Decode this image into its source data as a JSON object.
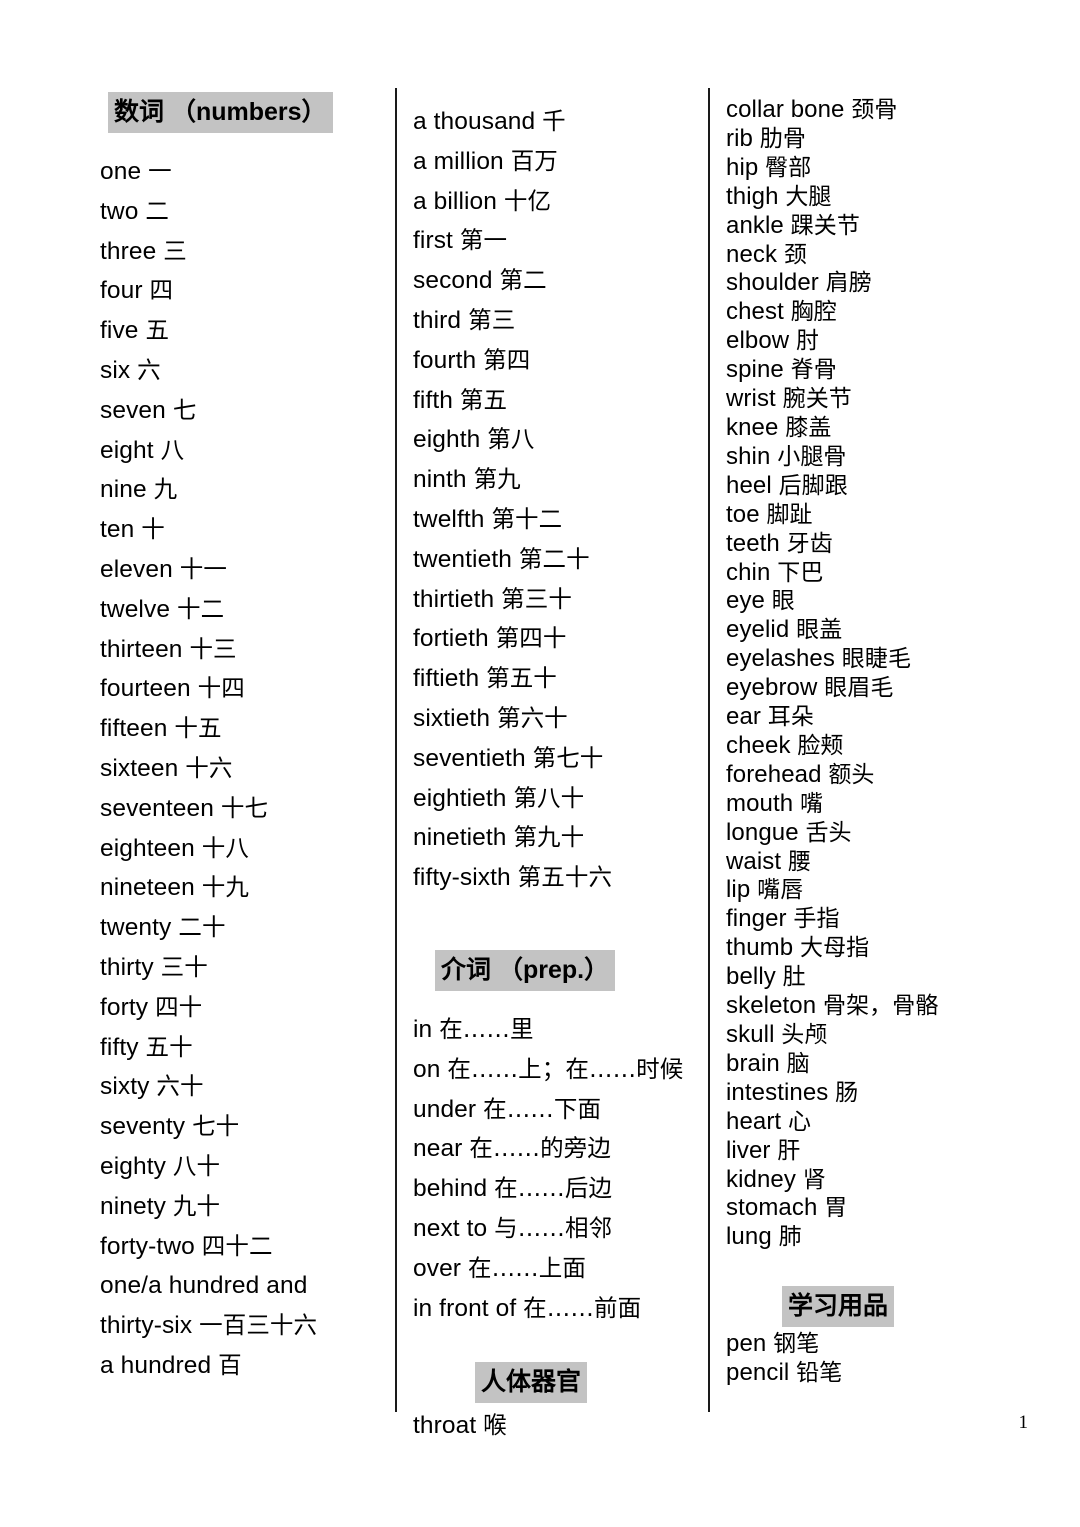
{
  "document": {
    "page_number": "1"
  },
  "columns": [
    {
      "id": "column-1",
      "sections": [
        {
          "heading": "数词 （numbers）",
          "entries": [
            {
              "en": "one",
              "cn": "一"
            },
            {
              "en": "two",
              "cn": "二"
            },
            {
              "en": "three",
              "cn": "三"
            },
            {
              "en": "four",
              "cn": "四"
            },
            {
              "en": "five",
              "cn": "五"
            },
            {
              "en": "six",
              "cn": "六"
            },
            {
              "en": "seven",
              "cn": "七"
            },
            {
              "en": "eight",
              "cn": "八"
            },
            {
              "en": "nine",
              "cn": "九"
            },
            {
              "en": "ten",
              "cn": "十"
            },
            {
              "en": "eleven",
              "cn": "十一"
            },
            {
              "en": "twelve",
              "cn": "十二"
            },
            {
              "en": "thirteen",
              "cn": "十三"
            },
            {
              "en": "fourteen",
              "cn": "十四"
            },
            {
              "en": "fifteen",
              "cn": "十五"
            },
            {
              "en": "sixteen",
              "cn": "十六"
            },
            {
              "en": "seventeen",
              "cn": "十七"
            },
            {
              "en": "eighteen",
              "cn": "十八"
            },
            {
              "en": "nineteen",
              "cn": "十九"
            },
            {
              "en": "twenty",
              "cn": "二十"
            },
            {
              "en": "thirty",
              "cn": "三十"
            },
            {
              "en": "forty",
              "cn": "四十"
            },
            {
              "en": "fifty",
              "cn": "五十"
            },
            {
              "en": "sixty",
              "cn": "六十"
            },
            {
              "en": "seventy",
              "cn": "七十"
            },
            {
              "en": "eighty",
              "cn": "八十"
            },
            {
              "en": "ninety",
              "cn": "九十"
            },
            {
              "en": "forty-two",
              "cn": "四十二"
            },
            {
              "en": "one/a hundred and",
              "cn": ""
            },
            {
              "en": "thirty-six",
              "cn": "一百三十六"
            },
            {
              "en": "a hundred",
              "cn": "百"
            }
          ]
        }
      ]
    },
    {
      "id": "column-2",
      "sections": [
        {
          "heading": "",
          "entries": [
            {
              "en": "a thousand",
              "cn": "千"
            },
            {
              "en": "a million",
              "cn": "百万"
            },
            {
              "en": "a billion",
              "cn": "十亿"
            },
            {
              "en": "first",
              "cn": "第一"
            },
            {
              "en": "second",
              "cn": "第二"
            },
            {
              "en": "third",
              "cn": "第三"
            },
            {
              "en": "fourth",
              "cn": "第四"
            },
            {
              "en": "fifth",
              "cn": "第五"
            },
            {
              "en": "eighth",
              "cn": "第八"
            },
            {
              "en": "ninth",
              "cn": "第九"
            },
            {
              "en": "twelfth",
              "cn": "第十二"
            },
            {
              "en": "twentieth",
              "cn": "第二十"
            },
            {
              "en": "thirtieth",
              "cn": "第三十"
            },
            {
              "en": "fortieth",
              "cn": "第四十"
            },
            {
              "en": "fiftieth",
              "cn": "第五十"
            },
            {
              "en": "sixtieth",
              "cn": "第六十"
            },
            {
              "en": "seventieth",
              "cn": "第七十"
            },
            {
              "en": "eightieth",
              "cn": "第八十"
            },
            {
              "en": "ninetieth",
              "cn": "第九十"
            },
            {
              "en": "fifty-sixth",
              "cn": "第五十六"
            }
          ]
        },
        {
          "heading": "介词 （prep.）",
          "entries": [
            {
              "en": "in",
              "cn": "在……里"
            },
            {
              "en": "on",
              "cn": "在……上；在……时候"
            },
            {
              "en": "under",
              "cn": "在……下面"
            },
            {
              "en": "near",
              "cn": "在……的旁边"
            },
            {
              "en": "behind",
              "cn": "在……后边"
            },
            {
              "en": "next to",
              "cn": "与……相邻"
            },
            {
              "en": "over",
              "cn": "在……上面"
            },
            {
              "en": "in front of",
              "cn": "在……前面"
            }
          ]
        },
        {
          "heading": "人体器官",
          "entries": [
            {
              "en": "throat",
              "cn": "喉"
            }
          ]
        }
      ]
    },
    {
      "id": "column-3",
      "sections": [
        {
          "heading": "",
          "entries": [
            {
              "en": "collar bone",
              "cn": "颈骨"
            },
            {
              "en": "rib",
              "cn": "肋骨"
            },
            {
              "en": "hip",
              "cn": "臀部"
            },
            {
              "en": "thigh",
              "cn": "大腿"
            },
            {
              "en": "ankle",
              "cn": "踝关节"
            },
            {
              "en": "neck",
              "cn": "颈"
            },
            {
              "en": "shoulder",
              "cn": "肩膀"
            },
            {
              "en": "chest",
              "cn": "胸腔"
            },
            {
              "en": "elbow",
              "cn": "肘"
            },
            {
              "en": "spine",
              "cn": "脊骨"
            },
            {
              "en": "wrist",
              "cn": "腕关节"
            },
            {
              "en": "knee",
              "cn": "膝盖"
            },
            {
              "en": "shin",
              "cn": "小腿骨"
            },
            {
              "en": "heel",
              "cn": "后脚跟"
            },
            {
              "en": "toe",
              "cn": "脚趾"
            },
            {
              "en": "teeth",
              "cn": "牙齿"
            },
            {
              "en": "chin",
              "cn": "下巴"
            },
            {
              "en": "eye",
              "cn": "眼"
            },
            {
              "en": "eyelid",
              "cn": "眼盖"
            },
            {
              "en": "eyelashes",
              "cn": "眼睫毛"
            },
            {
              "en": "eyebrow",
              "cn": "眼眉毛"
            },
            {
              "en": "ear",
              "cn": "耳朵"
            },
            {
              "en": "cheek",
              "cn": "脸颊"
            },
            {
              "en": "forehead",
              "cn": "额头"
            },
            {
              "en": "mouth",
              "cn": "嘴"
            },
            {
              "en": "longue",
              "cn": "舌头"
            },
            {
              "en": "waist",
              "cn": "腰"
            },
            {
              "en": "lip",
              "cn": "嘴唇"
            },
            {
              "en": "finger",
              "cn": "手指"
            },
            {
              "en": "thumb",
              "cn": "大母指"
            },
            {
              "en": "belly",
              "cn": "肚"
            },
            {
              "en": "skeleton",
              "cn": "骨架，骨骼"
            },
            {
              "en": "skull",
              "cn": "头颅"
            },
            {
              "en": "brain",
              "cn": "脑"
            },
            {
              "en": "intestines",
              "cn": "肠"
            },
            {
              "en": "heart",
              "cn": "心"
            },
            {
              "en": "liver",
              "cn": "肝"
            },
            {
              "en": "kidney",
              "cn": "肾"
            },
            {
              "en": "stomach",
              "cn": "胃"
            },
            {
              "en": "lung",
              "cn": "肺"
            }
          ]
        },
        {
          "heading": "学习用品",
          "entries": [
            {
              "en": "pen",
              "cn": "钢笔"
            },
            {
              "en": "pencil",
              "cn": "铅笔"
            }
          ]
        }
      ]
    }
  ],
  "style": {
    "highlight_color": "#c3c3c3",
    "text_color": "#000000",
    "background_color": "#ffffff",
    "divider_color": "#1a1a1a"
  }
}
